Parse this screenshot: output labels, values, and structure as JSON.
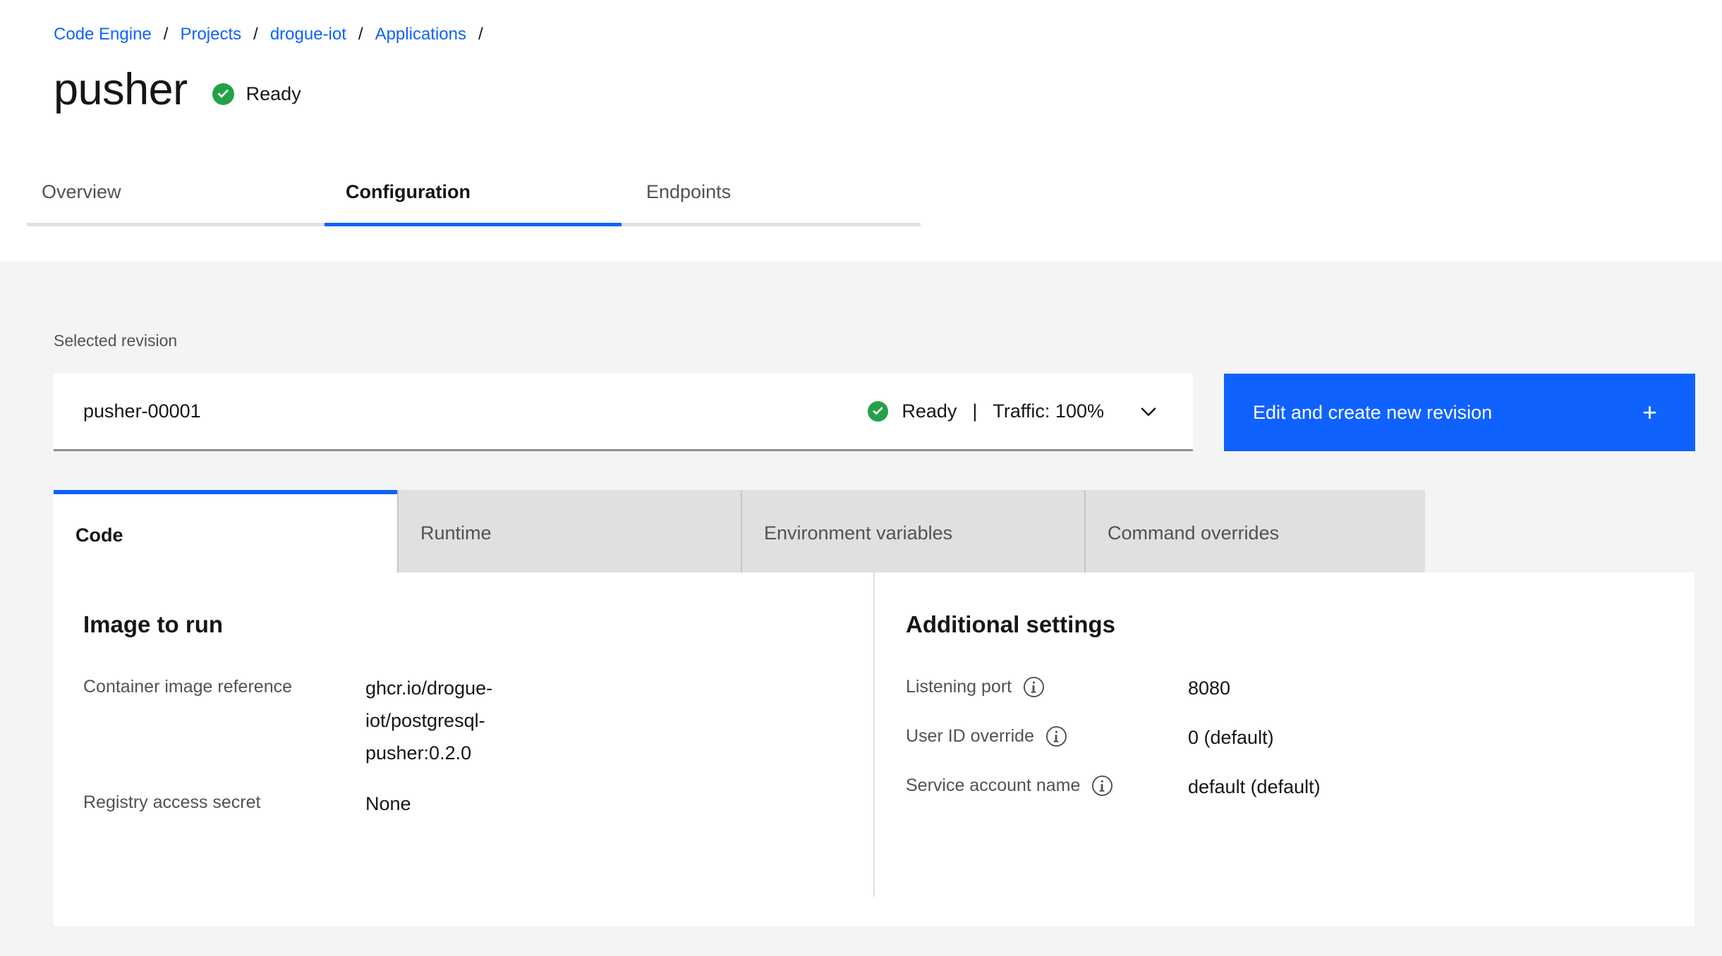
{
  "breadcrumb": {
    "items": [
      {
        "label": "Code Engine"
      },
      {
        "label": "Projects"
      },
      {
        "label": "drogue-iot"
      },
      {
        "label": "Applications"
      }
    ],
    "separator": "/"
  },
  "header": {
    "title": "pusher",
    "status": "Ready",
    "status_icon": "check-circle-filled-icon",
    "status_color": "#24a148"
  },
  "page_tabs": [
    {
      "label": "Overview",
      "active": false
    },
    {
      "label": "Configuration",
      "active": true
    },
    {
      "label": "Endpoints",
      "active": false
    }
  ],
  "revision": {
    "section_label": "Selected revision",
    "name": "pusher-00001",
    "status": "Ready",
    "status_icon": "check-circle-filled-icon",
    "divider": "|",
    "traffic": "Traffic: 100%",
    "chevron_icon": "chevron-down-icon"
  },
  "edit_button": {
    "label": "Edit and create new revision",
    "icon": "plus-icon",
    "icon_glyph": "+",
    "color": "#0f62fe"
  },
  "inner_tabs": [
    {
      "label": "Code",
      "active": true
    },
    {
      "label": "Runtime",
      "active": false
    },
    {
      "label": "Environment variables",
      "active": false
    },
    {
      "label": "Command overrides",
      "active": false
    }
  ],
  "image_to_run": {
    "title": "Image to run",
    "fields": [
      {
        "label": "Container image reference",
        "value": "ghcr.io/drogue-iot/postgresql-pusher:0.2.0",
        "info": false
      },
      {
        "label": "Registry access secret",
        "value": "None",
        "info": false
      }
    ]
  },
  "additional_settings": {
    "title": "Additional settings",
    "fields": [
      {
        "label": "Listening port",
        "value": "8080",
        "info": true,
        "info_icon": "info-icon"
      },
      {
        "label": "User ID override",
        "value": "0 (default)",
        "info": true,
        "info_icon": "info-icon"
      },
      {
        "label": "Service account name",
        "value": "default (default)",
        "info": true,
        "info_icon": "info-icon"
      }
    ]
  }
}
